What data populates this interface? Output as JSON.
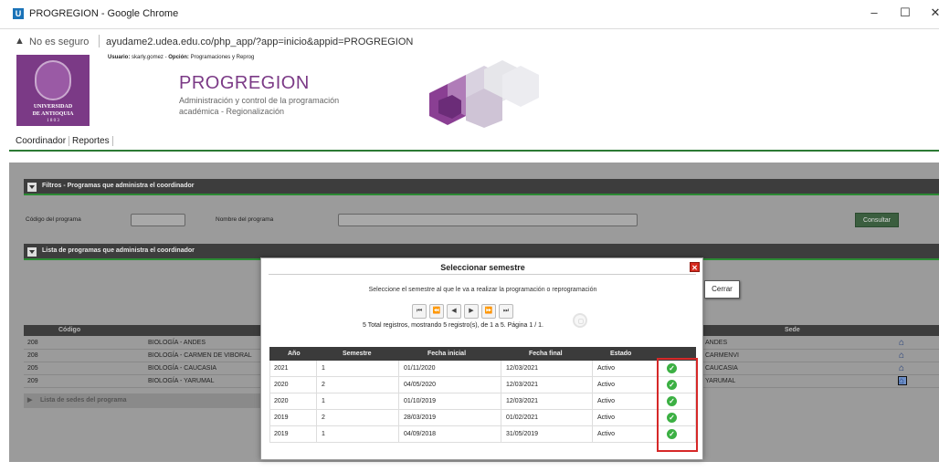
{
  "window": {
    "title": "PROGREGION - Google Chrome",
    "controls": {
      "minimize": "–",
      "maximize": "☐",
      "close": "✕"
    }
  },
  "addressbar": {
    "security_label": "No es seguro",
    "url": "ayudame2.udea.edu.co/php_app/?app=inicio&appid=PROGREGION"
  },
  "header": {
    "logo_line1": "UNIVERSIDAD",
    "logo_line2": "DE ANTIOQUIA",
    "logo_year": "1 8 0 3",
    "user_label": "Usuario:",
    "user_value": "skarly.gomez",
    "option_label": "Opción:",
    "option_value": "Programaciones y Reprog",
    "app_title": "PROGREGION",
    "app_subtitle1": "Administración y control de la programación",
    "app_subtitle2": "académica - Regionalización"
  },
  "nav": {
    "items": [
      "Coordinador",
      "Reportes"
    ]
  },
  "filters": {
    "title": "Filtros - Programas que administra el coordinador",
    "code_label": "Código del programa",
    "name_label": "Nombre del programa",
    "consultar_label": "Consultar"
  },
  "list": {
    "title": "Lista de programas que administra el coordinador",
    "columns": [
      "Código",
      "Sede"
    ],
    "rows": [
      {
        "code": "208",
        "name": "BIOLOGÍA - ANDES",
        "sede": "ANDES"
      },
      {
        "code": "208",
        "name": "BIOLOGÍA - CARMEN DE VIBORAL",
        "sede": "CARMENVI"
      },
      {
        "code": "205",
        "name": "BIOLOGÍA - CAUCASIA",
        "sede": "CAUCASIA"
      },
      {
        "code": "209",
        "name": "BIOLOGÍA - YARUMAL",
        "sede": "YARUMAL"
      }
    ],
    "sedes_title": "Lista de sedes del programa"
  },
  "modal": {
    "title": "Seleccionar semestre",
    "message": "Seleccione el semestre al que le va a realizar la programación o reprogramación",
    "pager_info": "5 Total registros, mostrando 5 registro(s), de 1 a 5. Página 1 / 1.",
    "pager_buttons": [
      "⏮",
      "⏪",
      "◀",
      "▶",
      "⏩",
      "⏭"
    ],
    "columns": [
      "Año",
      "Semestre",
      "Fecha inicial",
      "Fecha final",
      "Estado"
    ],
    "rows": [
      {
        "year": "2021",
        "semester": "1",
        "start": "01/11/2020",
        "end": "12/03/2021",
        "status": "Activo"
      },
      {
        "year": "2020",
        "semester": "2",
        "start": "04/05/2020",
        "end": "12/03/2021",
        "status": "Activo"
      },
      {
        "year": "2020",
        "semester": "1",
        "start": "01/10/2019",
        "end": "12/03/2021",
        "status": "Activo"
      },
      {
        "year": "2019",
        "semester": "2",
        "start": "28/03/2019",
        "end": "01/02/2021",
        "status": "Activo"
      },
      {
        "year": "2019",
        "semester": "1",
        "start": "04/09/2018",
        "end": "31/05/2019",
        "status": "Activo"
      }
    ]
  },
  "tooltip": {
    "close_label": "Cerrar"
  },
  "colors": {
    "brand_purple": "#7b3a86",
    "accent_green": "#2c7a34",
    "close_red": "#d52a1e",
    "check_green": "#3cb043"
  }
}
